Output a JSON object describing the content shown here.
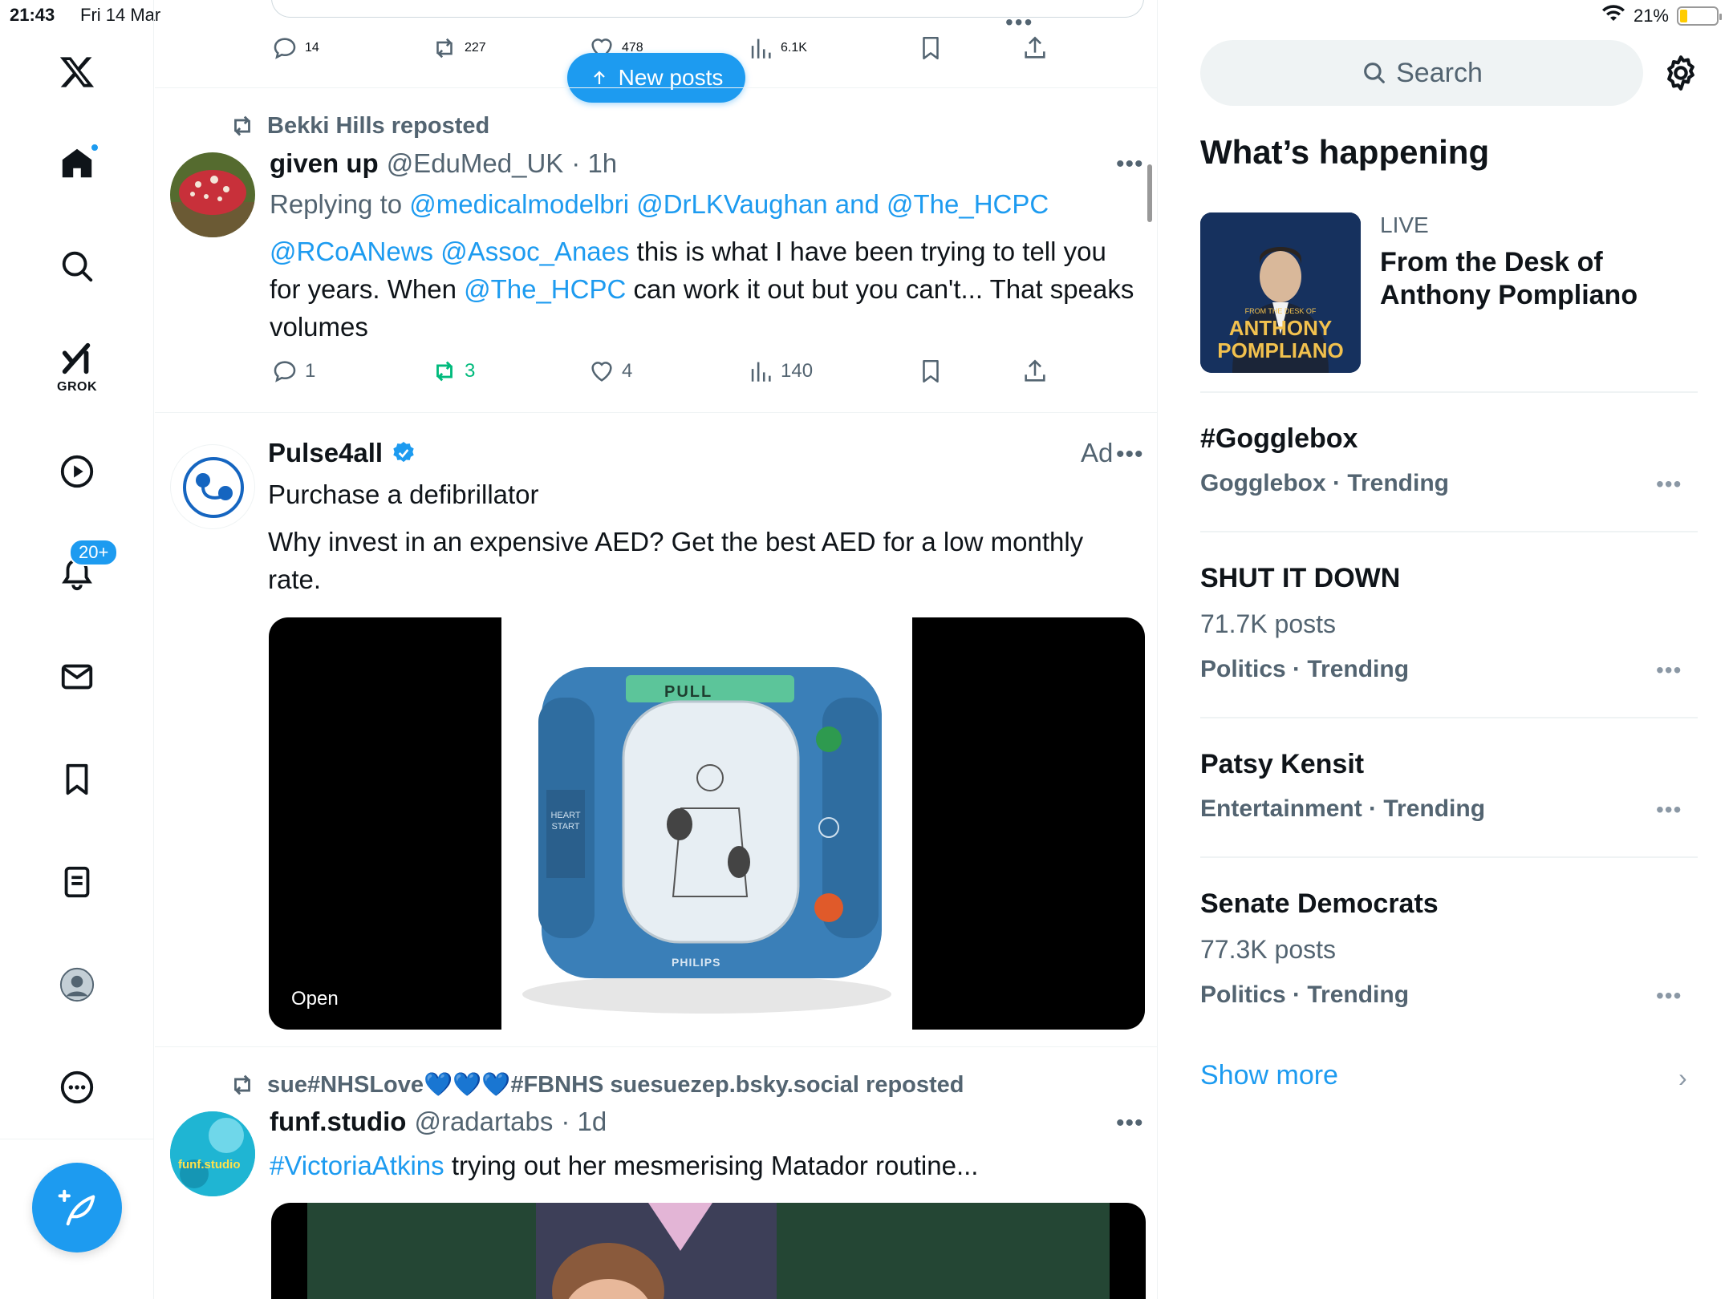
{
  "status": {
    "time": "21:43",
    "date": "Fri 14 Mar",
    "battery": "21%",
    "battery_level": 0.21
  },
  "nav": {
    "grok_label": "GROK",
    "notifications_badge": "20+"
  },
  "feed": {
    "top_tweet_actions": {
      "replies": "14",
      "reposts": "227",
      "likes": "478",
      "views": "6.1K"
    },
    "new_posts_label": "New posts",
    "tweet1": {
      "reposted_by": "Bekki Hills reposted",
      "name": "given up",
      "handle": "@EduMed_UK",
      "time": "· 1h",
      "replying_prefix": "Replying to",
      "replying_users": "@medicalmodelbri @DrLKVaughan and @The_HCPC",
      "mention1": "@RCoANews",
      "mention2": "@Assoc_Anaes",
      "text1": " this is what I have been trying to tell you for years. When ",
      "mention3": "@The_HCPC",
      "text2": " can work it out but you can't... That speaks volumes",
      "replies": "1",
      "reposts": "3",
      "likes": "4",
      "views": "140"
    },
    "ad": {
      "name": "Pulse4all",
      "ad_label": "Ad",
      "headline": "Purchase a defibrillator",
      "text": "Why invest in an expensive AED? Get the best AED for a low monthly rate.",
      "open_label": "Open",
      "device_pull": "PULL",
      "device_brand": "PHILIPS",
      "device_side": "HEART START"
    },
    "tweet2": {
      "reposted_by": "sue#NHSLove💙💙💙#FBNHS suesuezep.bsky.social reposted",
      "name": "funf.studio",
      "handle": "@radartabs",
      "time": "· 1d",
      "hashtag": "#VictoriaAtkins",
      "text": " trying out her mesmerising Matador routine...",
      "avatar_text": "funf.studio"
    }
  },
  "sidebar": {
    "search_placeholder": "Search",
    "section_title": "What’s happening",
    "live": {
      "label": "LIVE",
      "title": "From the Desk of Anthony Pompliano",
      "thumb_small": "FROM THE DESK OF",
      "thumb_line1": "ANTHONY",
      "thumb_line2": "POMPLIANO"
    },
    "trends": [
      {
        "title": "#Gogglebox",
        "posts": "",
        "category": "Gogglebox · Trending"
      },
      {
        "title": "SHUT IT DOWN",
        "posts": "71.7K posts",
        "category": "Politics · Trending"
      },
      {
        "title": "Patsy Kensit",
        "posts": "",
        "category": "Entertainment · Trending"
      },
      {
        "title": "Senate Democrats",
        "posts": "77.3K posts",
        "category": "Politics · Trending"
      }
    ],
    "show_more": "Show more"
  },
  "colors": {
    "accent": "#1d9bf0",
    "repost_green": "#00ba7c",
    "muted": "#536471"
  }
}
